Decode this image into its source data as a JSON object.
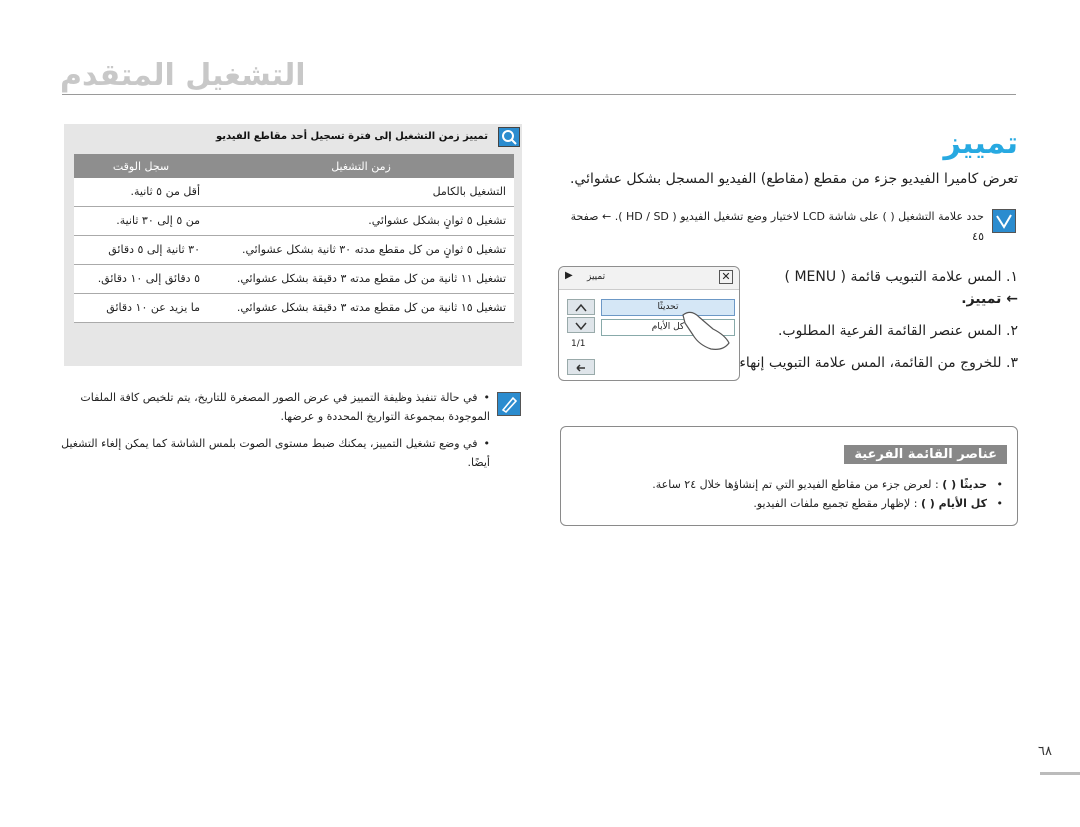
{
  "header": {
    "title": "التشغيل المتقدم"
  },
  "section": {
    "title": "تمييز",
    "intro": "تعرض كاميرا الفيديو جزء من مقطع (مقاطع) الفيديو المسجل بشكل عشوائي.",
    "note": "حدد علامة التشغيل ( ) على شاشة LCD لاختيار وضع تشغيل الفيديو ( HD / SD ). ← صفحة ٤٥",
    "steps": [
      {
        "num": "١.",
        "text": "المس علامة التبويب قائمة ( MENU )",
        "sub": "← تمييز."
      },
      {
        "num": "٢.",
        "text": "المس عنصر القائمة الفرعية المطلوب."
      },
      {
        "num": "٣.",
        "text": "للخروج من القائمة، المس علامة التبويب إنهاء ( ) أو عودة ( )."
      }
    ]
  },
  "camera_screen": {
    "title": "تمييز",
    "options": [
      "تحديثًا",
      "كل الأيام"
    ],
    "page_indicator": "1/1"
  },
  "table": {
    "title": "تمييز زمن التشغيل إلى فترة تسجيل أحد مقاطع الفيديو",
    "headers": [
      "زمن التشغيل",
      "سجل الوقت"
    ],
    "rows": [
      {
        "playback": "التشغيل بالكامل",
        "record_time": "أقل من ٥ ثانية."
      },
      {
        "playback": "تشغيل ٥ ثوانٍ بشكل عشوائي.",
        "record_time": "من ٥ إلى ٣٠ ثانية."
      },
      {
        "playback": "تشغيل ٥ ثوانٍ من كل مقطع مدته ٣٠ ثانية بشكل عشوائي.",
        "record_time": "٣٠ ثانية إلى ٥ دقائق"
      },
      {
        "playback": "تشغيل ١١ ثانية من كل مقطع مدته ٣ دقيقة بشكل عشوائي.",
        "record_time": "٥ دقائق إلى ١٠ دقائق."
      },
      {
        "playback": "تشغيل ١٥ ثانية من كل مقطع مدته ٣ دقيقة بشكل عشوائي.",
        "record_time": "ما يزيد عن ١٠ دقائق"
      }
    ]
  },
  "table_notes": [
    "في حالة تنفيذ وظيفة التمييز في عرض الصور المصغرة للتاريخ، يتم تلخيص كافة الملفات الموجودة بمجموعة التواريخ المحددة و عرضها.",
    "في وضع تشغيل التمييز، يمكنك ضبط مستوى الصوت بلمس الشاشة كما يمكن إلغاء التشغيل أيضًا."
  ],
  "advanced": {
    "title": "عناصر القائمة الفرعية",
    "items": [
      {
        "label": "حديثًا ( )",
        "desc": ": لعرض جزء من مقاطع الفيديو التي تم إنشاؤها خلال ٢٤ ساعة."
      },
      {
        "label": "كل الأيام ( )",
        "desc": ": لإظهار مقطع تجميع ملفات الفيديو."
      }
    ]
  },
  "footer": {
    "page_number": "٦٨"
  },
  "colors": {
    "accent": "#27a9e1",
    "table_header": "#8e8e8e",
    "panel_bg": "#e6e6e6"
  }
}
